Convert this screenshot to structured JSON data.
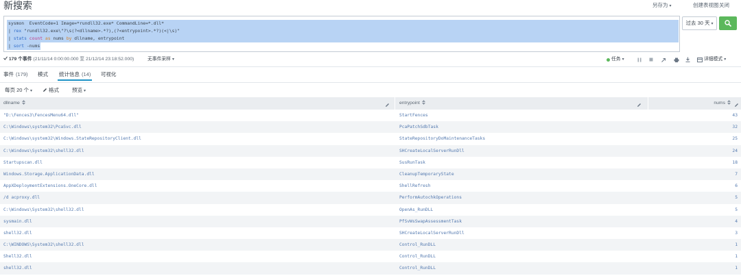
{
  "header": {
    "title": "新搜索",
    "save_as": "另存为",
    "create_table_view": "创建表视图",
    "close": "关闭"
  },
  "search": {
    "lines": [
      [
        {
          "text": "sysmon  EventCode=1 Image=*rundll32.exe* CommandLine=*.dll*",
          "color": "#3c444d"
        }
      ],
      [
        {
          "text": "| ",
          "color": "#3c444d"
        },
        {
          "text": "rex",
          "color": "#2f6bc7"
        },
        {
          "text": " \"rundll32.exe\\\"?\\s(?<dllname>.*?),(?<entrypoint>.*?)(<|\\s)\"",
          "color": "#3c444d"
        }
      ],
      [
        {
          "text": "| ",
          "color": "#3c444d"
        },
        {
          "text": "stats",
          "color": "#2f6bc7"
        },
        {
          "text": " count",
          "color": "#c2408a"
        },
        {
          "text": " as",
          "color": "#d9822b"
        },
        {
          "text": " nums",
          "color": "#3c444d"
        },
        {
          "text": " by",
          "color": "#d9822b"
        },
        {
          "text": " dllname, entrypoint",
          "color": "#3c444d"
        }
      ],
      [
        {
          "text": "| ",
          "color": "#3c444d"
        },
        {
          "text": "sort",
          "color": "#2f6bc7"
        },
        {
          "text": " -nums",
          "color": "#3c444d"
        }
      ]
    ],
    "time_range": "过去 30 天",
    "button_icon": "search-icon"
  },
  "status": {
    "event_count": "179 个事件",
    "time_span": "(21/11/14 0:00:00.000 至 21/12/14 23:18:52.000)",
    "sampling": "无事件采样",
    "job": "任务",
    "mode": "详细模式",
    "icons": [
      "check-icon",
      "pause-icon",
      "stop-icon",
      "share-icon",
      "print-icon",
      "export-icon",
      "verbose-mode-icon"
    ]
  },
  "tabs": [
    {
      "label": "事件",
      "count": "(179)",
      "active": false
    },
    {
      "label": "模式",
      "active": false
    },
    {
      "label": "统计信息",
      "count": "(14)",
      "active": true
    },
    {
      "label": "可视化",
      "active": false
    }
  ],
  "toolbar": {
    "per_page": "每页 20 个",
    "format": "格式",
    "preview": "预览"
  },
  "table": {
    "columns": [
      "dllname",
      "entrypoint",
      "nums"
    ],
    "rows": [
      {
        "dllname": "\"D:\\Fences3\\FencesMenu64.dll\"",
        "entrypoint": "StartFences",
        "nums": 43
      },
      {
        "dllname": "C:\\Windows\\system32\\PcaSvc.dll",
        "entrypoint": "PcaPatchSdbTask",
        "nums": 32
      },
      {
        "dllname": "C:\\Windows\\system32\\Windows.StateRepositoryClient.dll",
        "entrypoint": "StateRepositoryDoMaintenanceTasks",
        "nums": 25
      },
      {
        "dllname": "C:\\Windows\\System32\\shell32.dll",
        "entrypoint": "SHCreateLocalServerRunDll",
        "nums": 24
      },
      {
        "dllname": "Startupscan.dll",
        "entrypoint": "SusRunTask",
        "nums": 18
      },
      {
        "dllname": "Windows.Storage.ApplicationData.dll",
        "entrypoint": "CleanupTemporaryState",
        "nums": 7
      },
      {
        "dllname": "AppXDeploymentExtensions.OneCore.dll",
        "entrypoint": "ShellRefresh",
        "nums": 6
      },
      {
        "dllname": "/d acproxy.dll",
        "entrypoint": "PerformAutochkOperations",
        "nums": 5
      },
      {
        "dllname": "C:\\Windows\\System32\\shell32.dll",
        "entrypoint": "OpenAs_RunDLL",
        "nums": 5
      },
      {
        "dllname": "sysmain.dll",
        "entrypoint": "PfSvWsSwapAssessmentTask",
        "nums": 4
      },
      {
        "dllname": "shell32.dll",
        "entrypoint": "SHCreateLocalServerRunDll",
        "nums": 3
      },
      {
        "dllname": "C:\\WINDOWS\\System32\\shell32.dll",
        "entrypoint": "Control_RunDLL",
        "nums": 1
      },
      {
        "dllname": "Shell32.dll",
        "entrypoint": "Control_RunDLL",
        "nums": 1
      },
      {
        "dllname": "shell32.dll",
        "entrypoint": "Control_RunDLL",
        "nums": 1
      }
    ]
  },
  "colors": {
    "accent_green": "#5cb85c",
    "link_blue": "#5379af",
    "tab_active": "#1e93c6",
    "job_running": "#5cb85c"
  }
}
